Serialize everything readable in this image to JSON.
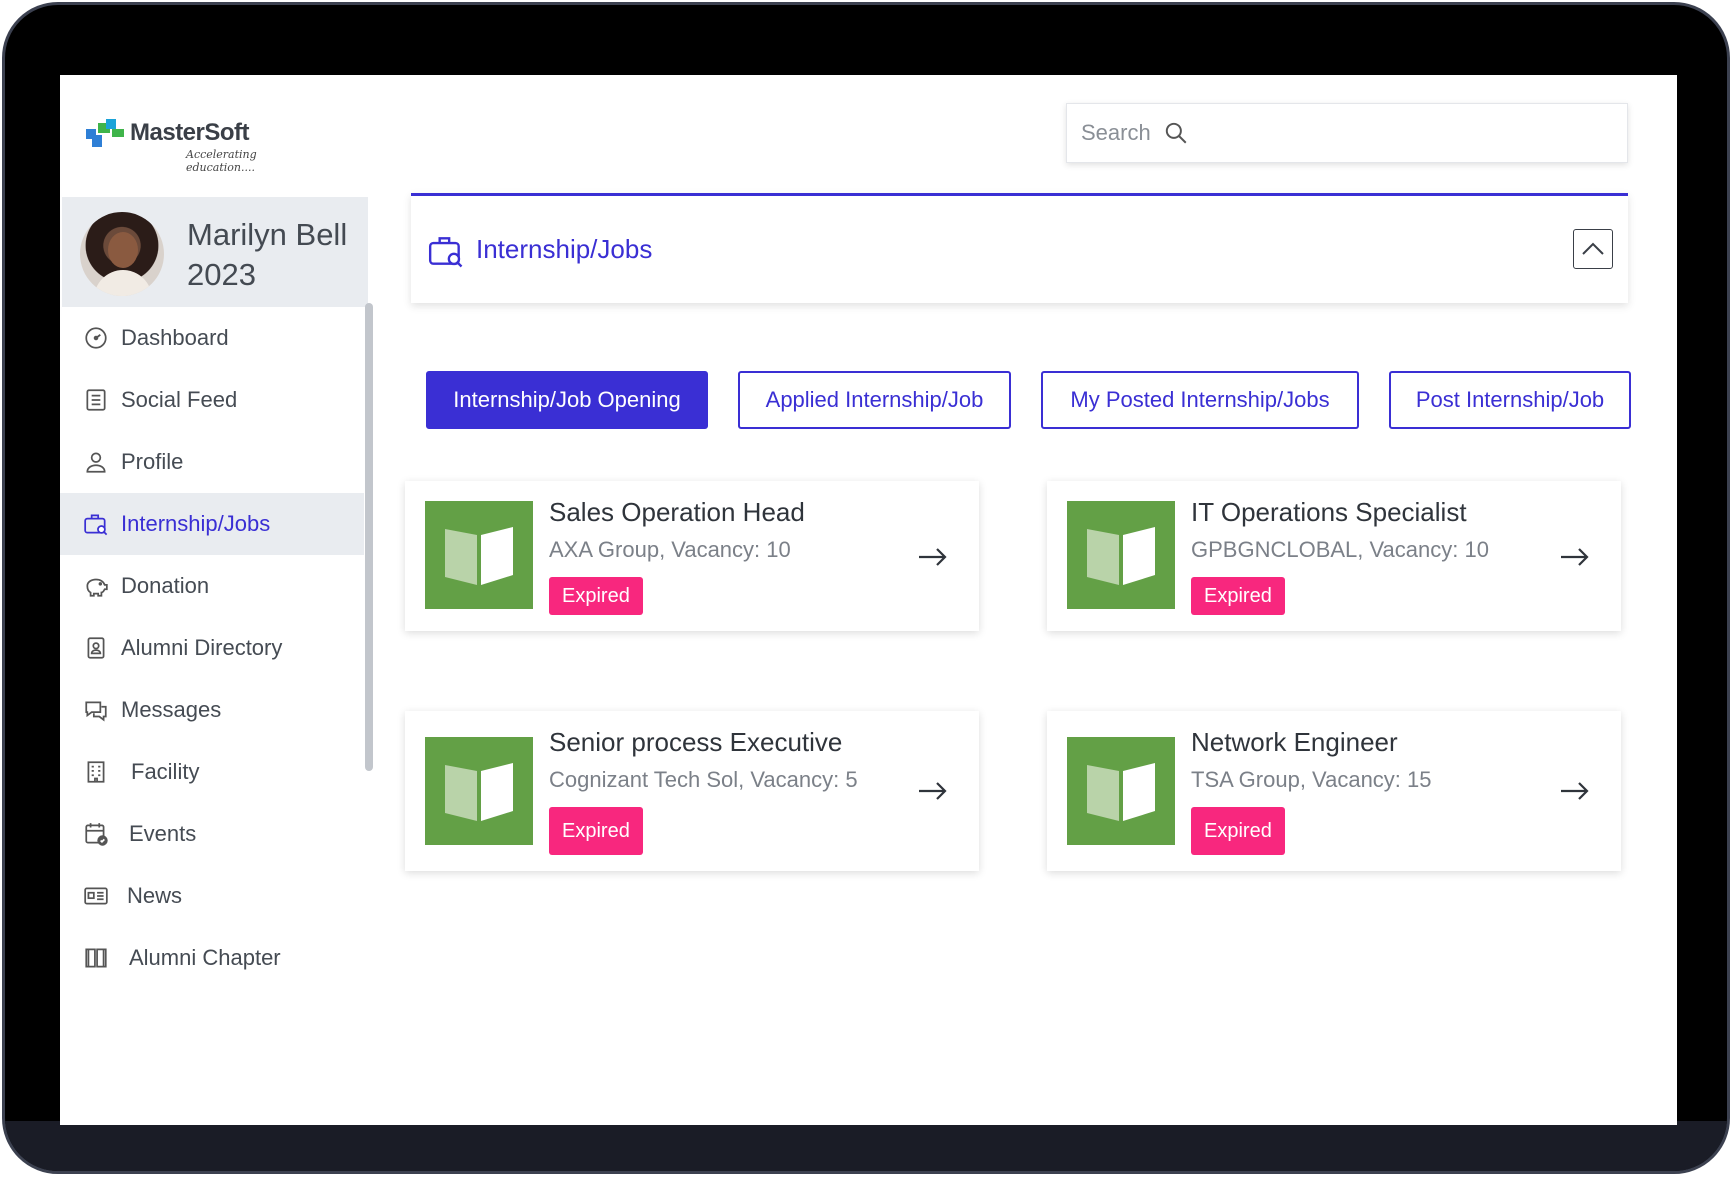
{
  "brand": {
    "name": "MasterSoft",
    "tagline": "Accelerating education...."
  },
  "user": {
    "name": "Marilyn Bell",
    "year": "2023"
  },
  "search": {
    "placeholder": "Search"
  },
  "sidebar": {
    "items": [
      {
        "label": "Dashboard",
        "icon": "dashboard-icon"
      },
      {
        "label": "Social Feed",
        "icon": "social-feed-icon"
      },
      {
        "label": "Profile",
        "icon": "profile-icon"
      },
      {
        "label": "Internship/Jobs",
        "icon": "briefcase-search-icon",
        "active": true
      },
      {
        "label": "Donation",
        "icon": "piggy-bank-icon"
      },
      {
        "label": "Alumni Directory",
        "icon": "directory-icon"
      },
      {
        "label": "Messages",
        "icon": "messages-icon"
      },
      {
        "label": "Facility",
        "icon": "building-icon"
      },
      {
        "label": "Events",
        "icon": "calendar-check-icon"
      },
      {
        "label": "News",
        "icon": "newspaper-icon"
      },
      {
        "label": "Alumni Chapter",
        "icon": "book-icon"
      }
    ]
  },
  "section": {
    "title": "Internship/Jobs"
  },
  "tabs": [
    {
      "label": "Internship/Job Opening",
      "active": true
    },
    {
      "label": "Applied Internship/Job"
    },
    {
      "label": "My Posted Internship/Jobs"
    },
    {
      "label": "Post Internship/Job"
    }
  ],
  "jobs": [
    {
      "title": "Sales Operation Head",
      "meta": "AXA Group, Vacancy: 10",
      "status": "Expired"
    },
    {
      "title": "IT Operations Specialist",
      "meta": "GPBGNCLOBAL, Vacancy: 10",
      "status": "Expired"
    },
    {
      "title": "Senior process Executive",
      "meta": "Cognizant Tech Sol, Vacancy: 5",
      "status": "Expired"
    },
    {
      "title": "Network Engineer",
      "meta": "TSA Group, Vacancy: 15",
      "status": "Expired"
    }
  ],
  "colors": {
    "accent": "#3a2fd4",
    "expired": "#f8277e",
    "thumb": "#63a046"
  }
}
